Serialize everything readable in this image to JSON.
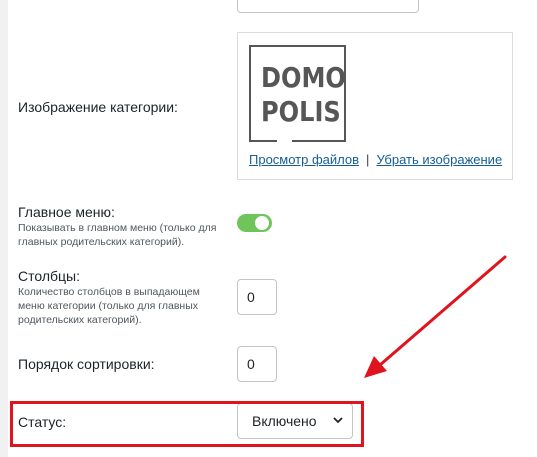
{
  "form": {
    "image": {
      "label": "Изображение категории:",
      "logo_lines": [
        "DOMO",
        "POLIS"
      ],
      "browse_link": "Просмотр файлов",
      "separator": "|",
      "remove_link": "Убрать изображение"
    },
    "main_menu": {
      "label": "Главное меню:",
      "description": "Показывать в главном меню (только для главных родительских категорий).",
      "enabled": true
    },
    "columns": {
      "label": "Столбцы:",
      "description": "Количество столбцов в выпадающем меню категории (только для главных родительских категорий).",
      "value": "0"
    },
    "sort_order": {
      "label": "Порядок сортировки:",
      "value": "0"
    },
    "status": {
      "label": "Статус:",
      "value": "Включено"
    }
  },
  "colors": {
    "toggle_on": "#70c55a",
    "link": "#135e96",
    "annotation_red": "#e0141e"
  }
}
